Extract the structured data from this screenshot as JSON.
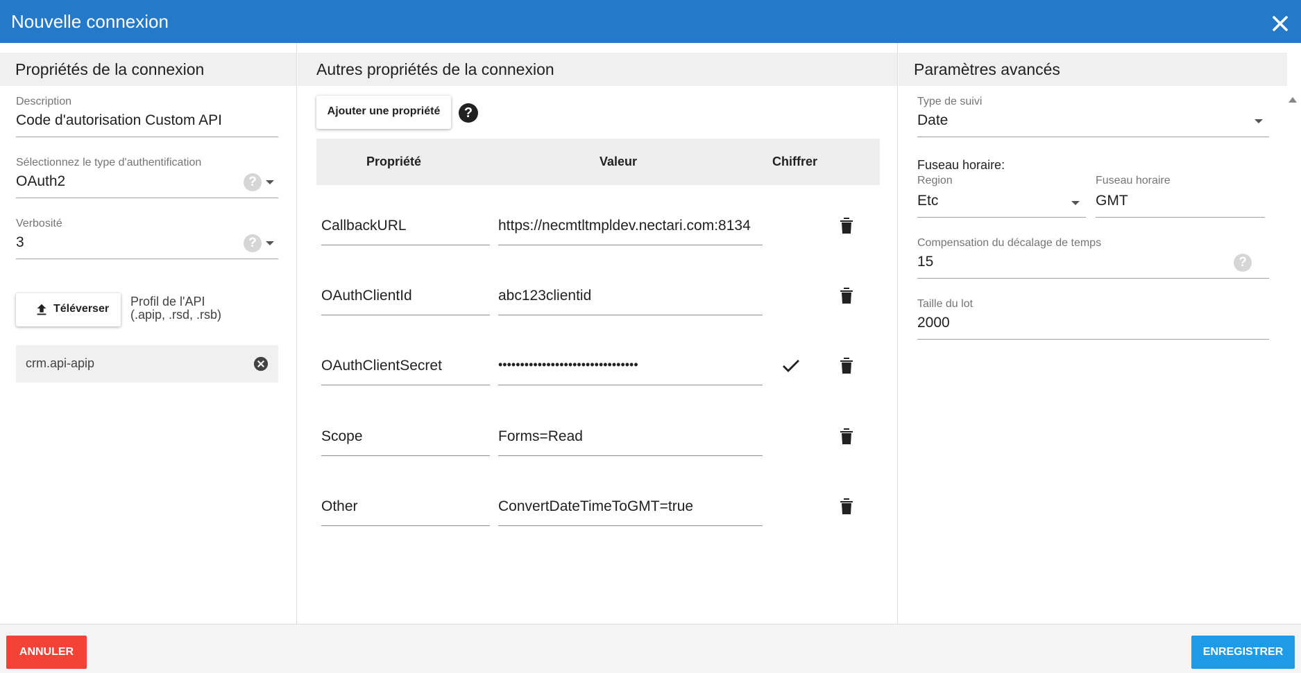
{
  "dialog": {
    "title": "Nouvelle connexion"
  },
  "colors": {
    "header": "#2479c8",
    "cancel": "#f44336",
    "save": "#1e9be6"
  },
  "left": {
    "header": "Propriétés de la connexion",
    "description": {
      "label": "Description",
      "value": "Code d'autorisation Custom API"
    },
    "auth_type": {
      "label": "Sélectionnez le type d'authentification",
      "value": "OAuth2",
      "help": "?"
    },
    "verbosity": {
      "label": "Verbosité",
      "value": "3",
      "help": "?"
    },
    "upload": {
      "label": "Téléverser",
      "icon": "upload-icon",
      "profile_line1": "Profil de l'API",
      "profile_line2": "(.apip, .rsd, .rsb)"
    },
    "file_chip": {
      "name": "crm.api-apip",
      "icon": "remove-circle-icon"
    }
  },
  "middle": {
    "header": "Autres propriétés de la connexion",
    "add_button": "Ajouter une propriété",
    "help": "?",
    "columns": {
      "property": "Propriété",
      "value": "Valeur",
      "encrypt": "Chiffrer"
    },
    "rows": [
      {
        "property": "CallbackURL",
        "value": "https://necmtltmpldev.nectari.com:8134",
        "encrypted": false
      },
      {
        "property": "OAuthClientId",
        "value": "abc123clientid",
        "encrypted": false
      },
      {
        "property": "OAuthClientSecret",
        "value": "••••••••••••••••••••••••••••••••",
        "encrypted": true
      },
      {
        "property": "Scope",
        "value": "Forms=Read",
        "encrypted": false
      },
      {
        "property": "Other",
        "value": "ConvertDateTimeToGMT=true",
        "encrypted": false
      }
    ]
  },
  "right": {
    "header": "Paramètres avancés",
    "tracking": {
      "label": "Type de suivi",
      "value": "Date"
    },
    "timezone_title": "Fuseau horaire:",
    "region": {
      "label": "Region",
      "value": "Etc"
    },
    "timezone": {
      "label": "Fuseau horaire",
      "value": "GMT"
    },
    "offset": {
      "label": "Compensation du décalage de temps",
      "value": "15",
      "help": "?"
    },
    "batch": {
      "label": "Taille du lot",
      "value": "2000"
    }
  },
  "footer": {
    "cancel": "ANNULER",
    "save": "ENREGISTRER"
  }
}
